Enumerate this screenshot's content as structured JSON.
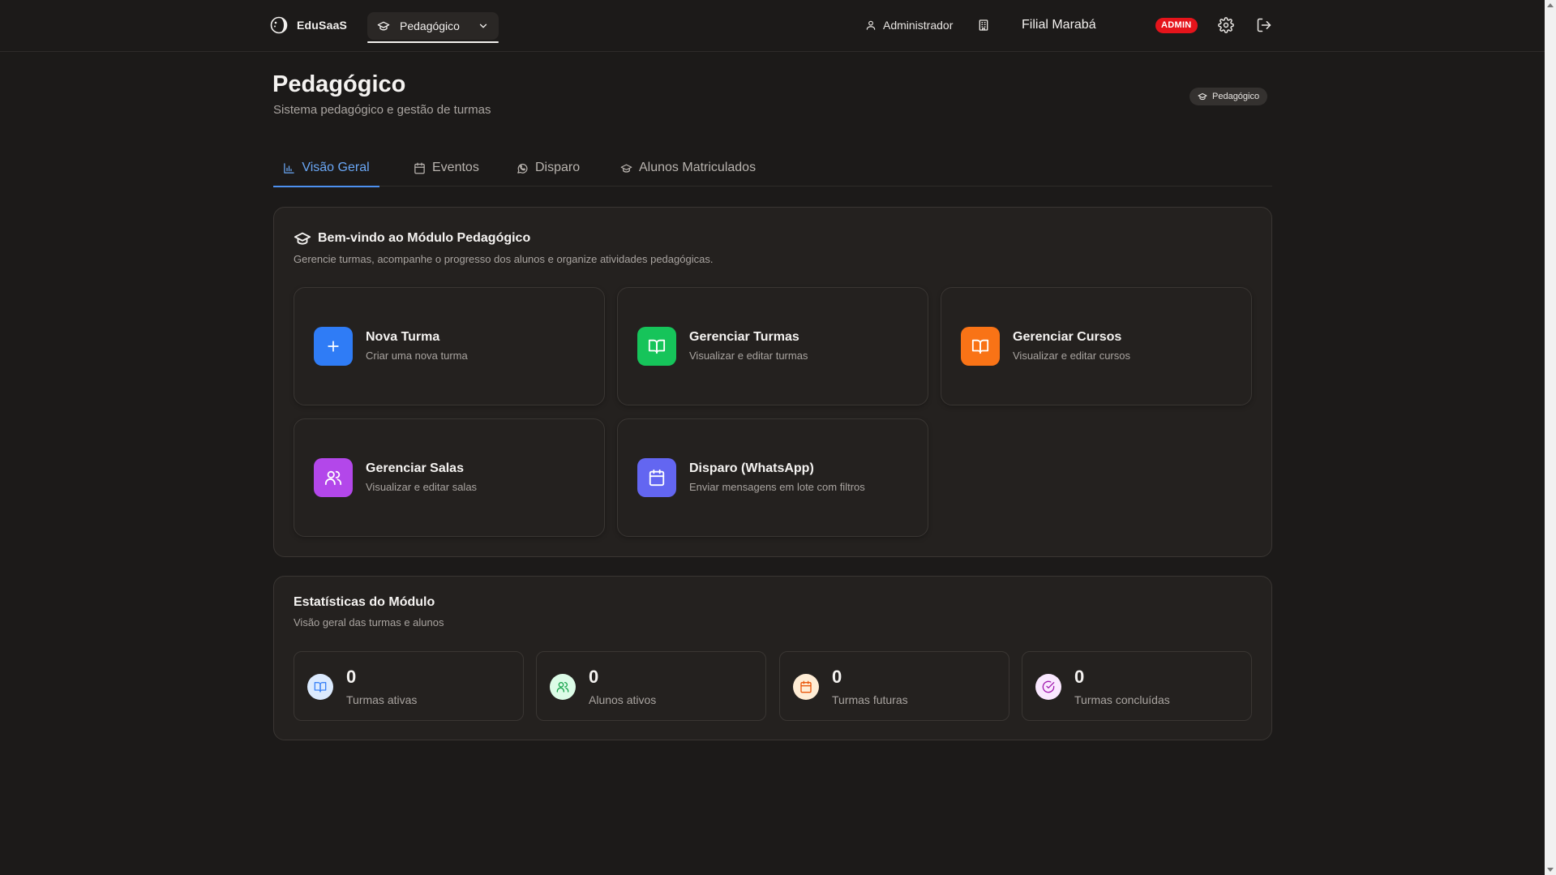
{
  "topbar": {
    "brand": "EduSaaS",
    "module_switch": "Pedagógico",
    "user": "Administrador",
    "branch": "Filial Marabá",
    "role_badge": "ADMIN"
  },
  "header": {
    "title": "Pedagógico",
    "subtitle": "Sistema pedagógico e gestão de turmas",
    "chip": "Pedagógico"
  },
  "tabs": [
    {
      "label": "Visão Geral",
      "icon": "bar-chart-icon",
      "active": true
    },
    {
      "label": "Eventos",
      "icon": "calendar-icon",
      "active": false
    },
    {
      "label": "Disparo",
      "icon": "whatsapp-icon",
      "active": false
    },
    {
      "label": "Alunos Matriculados",
      "icon": "graduation-cap-icon",
      "active": false
    }
  ],
  "welcome": {
    "title": "Bem-vindo ao Módulo Pedagógico",
    "subtitle": "Gerencie turmas, acompanhe o progresso dos alunos e organize atividades pedagógicas.",
    "actions": [
      {
        "title": "Nova Turma",
        "desc": "Criar uma nova turma",
        "icon": "plus-icon",
        "color": "#2f7cf6"
      },
      {
        "title": "Gerenciar Turmas",
        "desc": "Visualizar e editar turmas",
        "icon": "book-open-icon",
        "color": "#16c45a"
      },
      {
        "title": "Gerenciar Cursos",
        "desc": "Visualizar e editar cursos",
        "icon": "book-open-icon",
        "color": "#f97316"
      },
      {
        "title": "Gerenciar Salas",
        "desc": "Visualizar e editar salas",
        "icon": "users-icon",
        "color": "#b347ea"
      },
      {
        "title": "Disparo (WhatsApp)",
        "desc": "Enviar mensagens em lote com filtros",
        "icon": "calendar-icon",
        "color": "#6366f1"
      }
    ]
  },
  "stats": {
    "title": "Estatísticas do Módulo",
    "subtitle": "Visão geral das turmas e alunos",
    "items": [
      {
        "value": "0",
        "label": "Turmas ativas",
        "icon": "book-open-icon",
        "color": "#3b82f6",
        "bg": "#dbeafe"
      },
      {
        "value": "0",
        "label": "Alunos ativos",
        "icon": "users-icon",
        "color": "#16a34a",
        "bg": "#dcfce7"
      },
      {
        "value": "0",
        "label": "Turmas futuras",
        "icon": "calendar-icon",
        "color": "#ea580c",
        "bg": "#ffedd5"
      },
      {
        "value": "0",
        "label": "Turmas concluídas",
        "icon": "check-circle-icon",
        "color": "#a21caf",
        "bg": "#fae8ff"
      }
    ]
  }
}
